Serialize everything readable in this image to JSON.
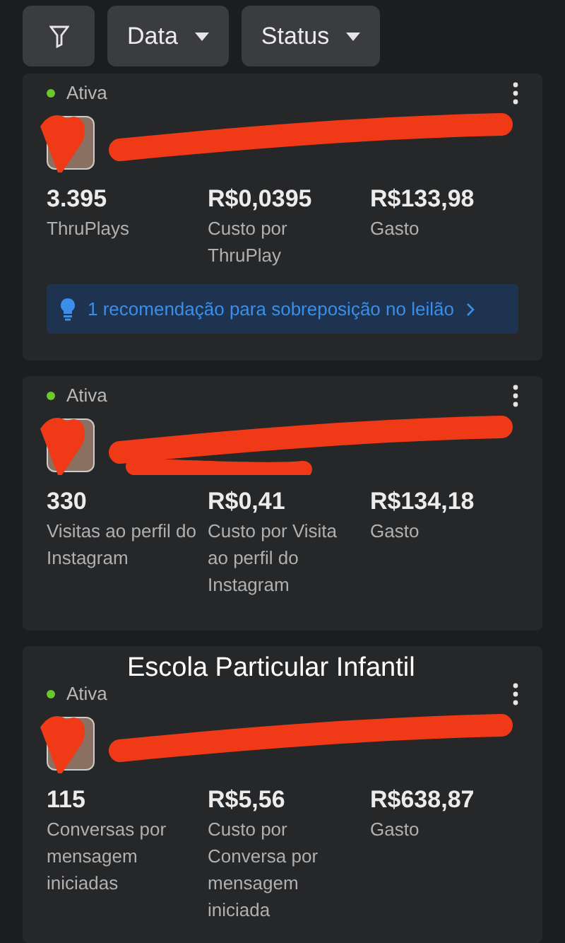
{
  "filter_bar": {
    "buttons": [
      {
        "kind": "filter"
      },
      {
        "kind": "dropdown",
        "label": "Data"
      },
      {
        "kind": "dropdown",
        "label": "Status"
      }
    ]
  },
  "campaigns": [
    {
      "status": "Ativa",
      "metrics": [
        {
          "value": "3.395",
          "label": "ThruPlays"
        },
        {
          "value": "R$0,0395",
          "label": "Custo por ThruPlay"
        },
        {
          "value": "R$133,98",
          "label": "Gasto"
        }
      ],
      "recommendation": "1 recomendação para sobreposição no leilão"
    },
    {
      "status": "Ativa",
      "metrics": [
        {
          "value": "330",
          "label": "Visitas ao perfil do Instagram"
        },
        {
          "value": "R$0,41",
          "label": "Custo por Visita ao perfil do Instagram"
        },
        {
          "value": "R$134,18",
          "label": "Gasto"
        }
      ]
    },
    {
      "caption": "Escola Particular Infantil",
      "status": "Ativa",
      "metrics": [
        {
          "value": "115",
          "label": "Conversas por mensagem iniciadas"
        },
        {
          "value": "R$5,56",
          "label": "Custo por Conversa por mensagem iniciada"
        },
        {
          "value": "R$638,87",
          "label": "Gasto"
        }
      ]
    }
  ]
}
